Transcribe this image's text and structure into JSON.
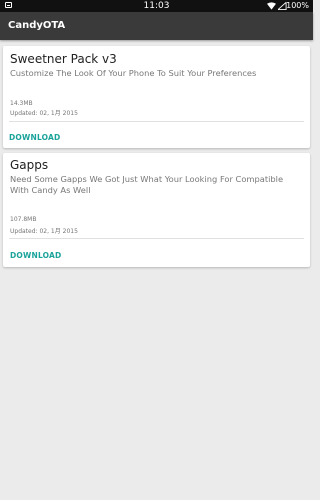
{
  "status_bar": {
    "time": "11:03",
    "battery": "100%",
    "icons": [
      "notification-icon",
      "wifi-icon",
      "signal-icon"
    ]
  },
  "app_bar": {
    "title": "CandyOTA"
  },
  "cards": [
    {
      "title": "Sweetner Pack v3",
      "description": "Customize The Look Of Your Phone To Suit Your Preferences",
      "size": "14.3MB",
      "updated": "Updated: 02, 1月 2015",
      "action": "DOWNLOAD"
    },
    {
      "title": "Gapps",
      "description": "Need Some Gapps We Got Just What Your Looking For Compatible With Candy As Well",
      "size": "107.8MB",
      "updated": "Updated: 02, 1月 2015",
      "action": "DOWNLOAD"
    }
  ],
  "colors": {
    "status_bar": "#111111",
    "app_bar": "#3a3a3a",
    "background": "#ebebeb",
    "accent": "#1aa39a"
  }
}
